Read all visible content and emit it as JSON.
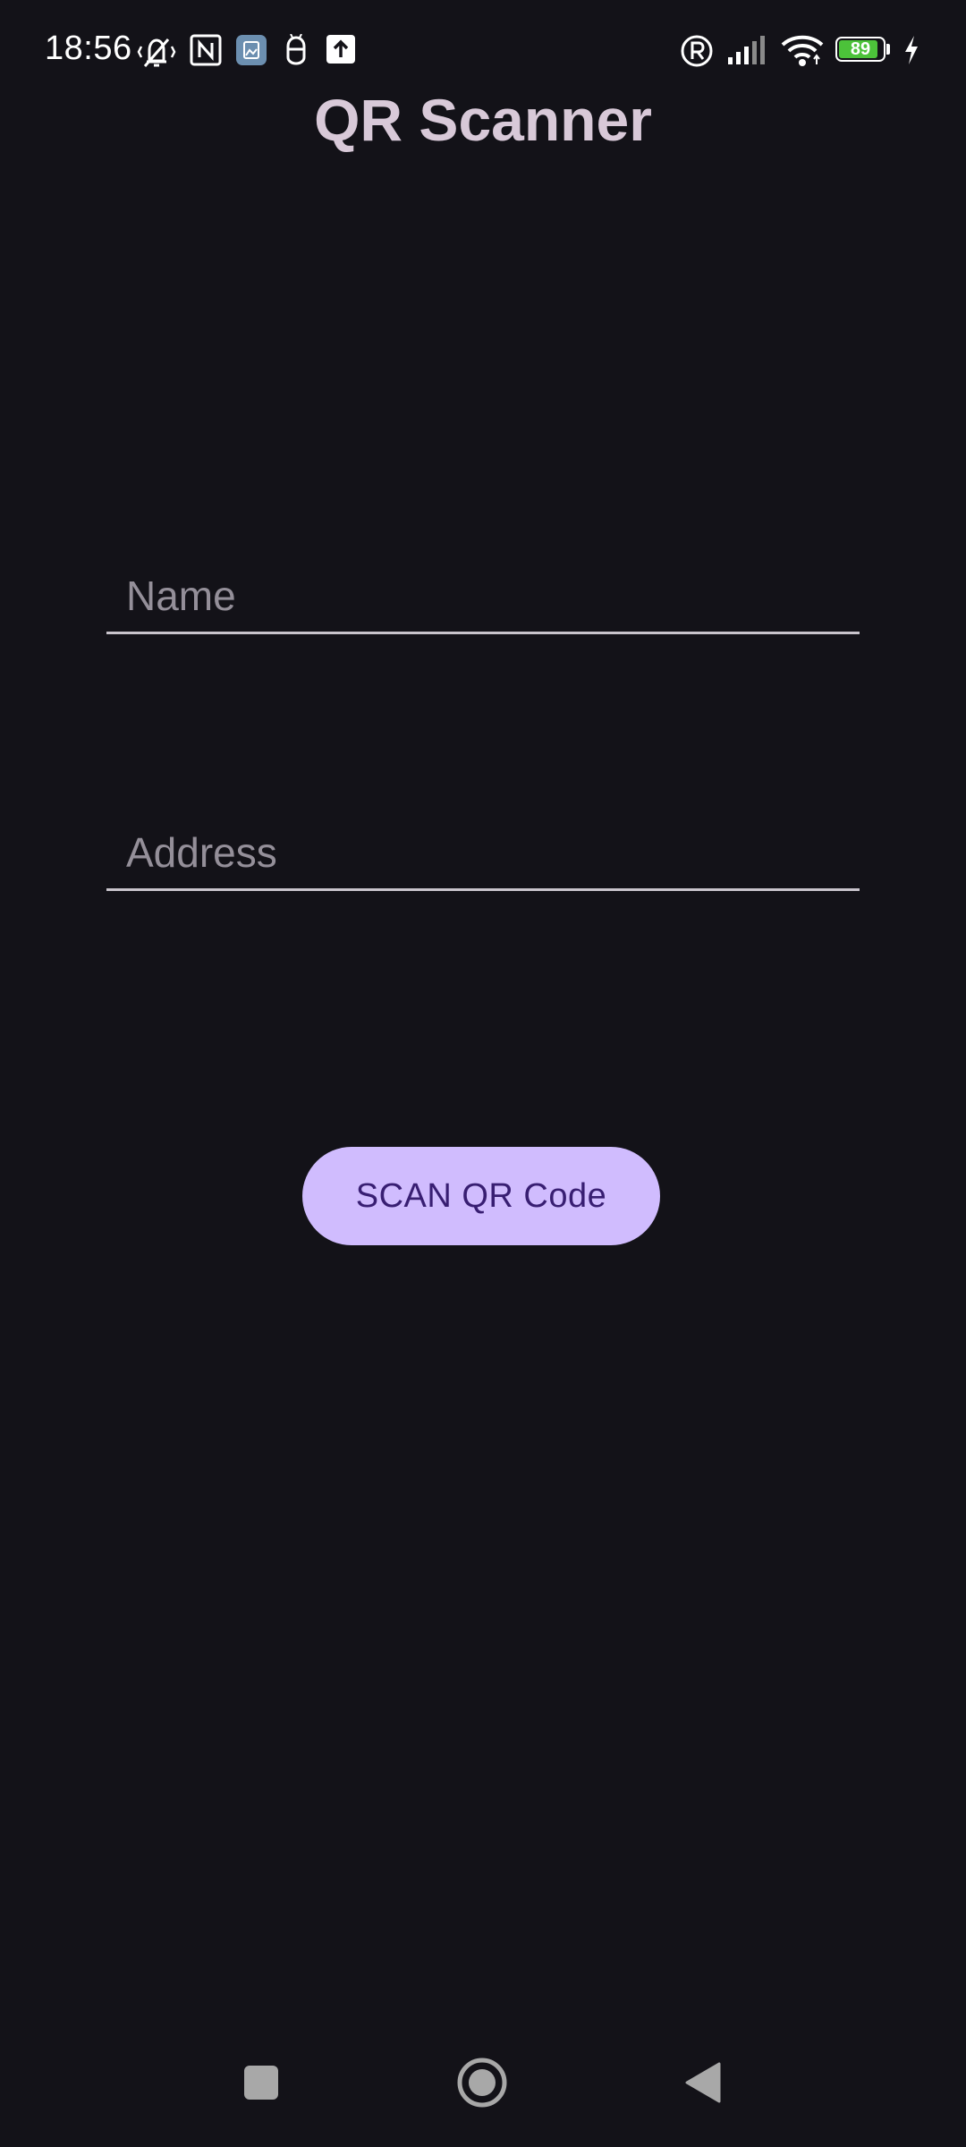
{
  "status_bar": {
    "time": "18:56",
    "battery_level": "89",
    "battery_fraction": 0.89,
    "icons": [
      "vibrate-off-icon",
      "nfc-icon",
      "gallery-notification-icon",
      "robot-notification-icon",
      "upload-icon",
      "registered-icon",
      "signal-icon",
      "wifi-icon",
      "battery-icon",
      "charging-icon"
    ]
  },
  "header": {
    "title": "QR Scanner"
  },
  "form": {
    "name_placeholder": "Name",
    "address_placeholder": "Address"
  },
  "actions": {
    "scan_label": "SCAN QR Code"
  },
  "nav": {
    "icons": [
      "recents-square-icon",
      "home-circle-icon",
      "back-triangle-icon"
    ]
  },
  "colors": {
    "background": "#131218",
    "button": "#d0bcfe",
    "button_text": "#381e72",
    "title": "#d8c9d8",
    "battery": "#4cc23a"
  }
}
